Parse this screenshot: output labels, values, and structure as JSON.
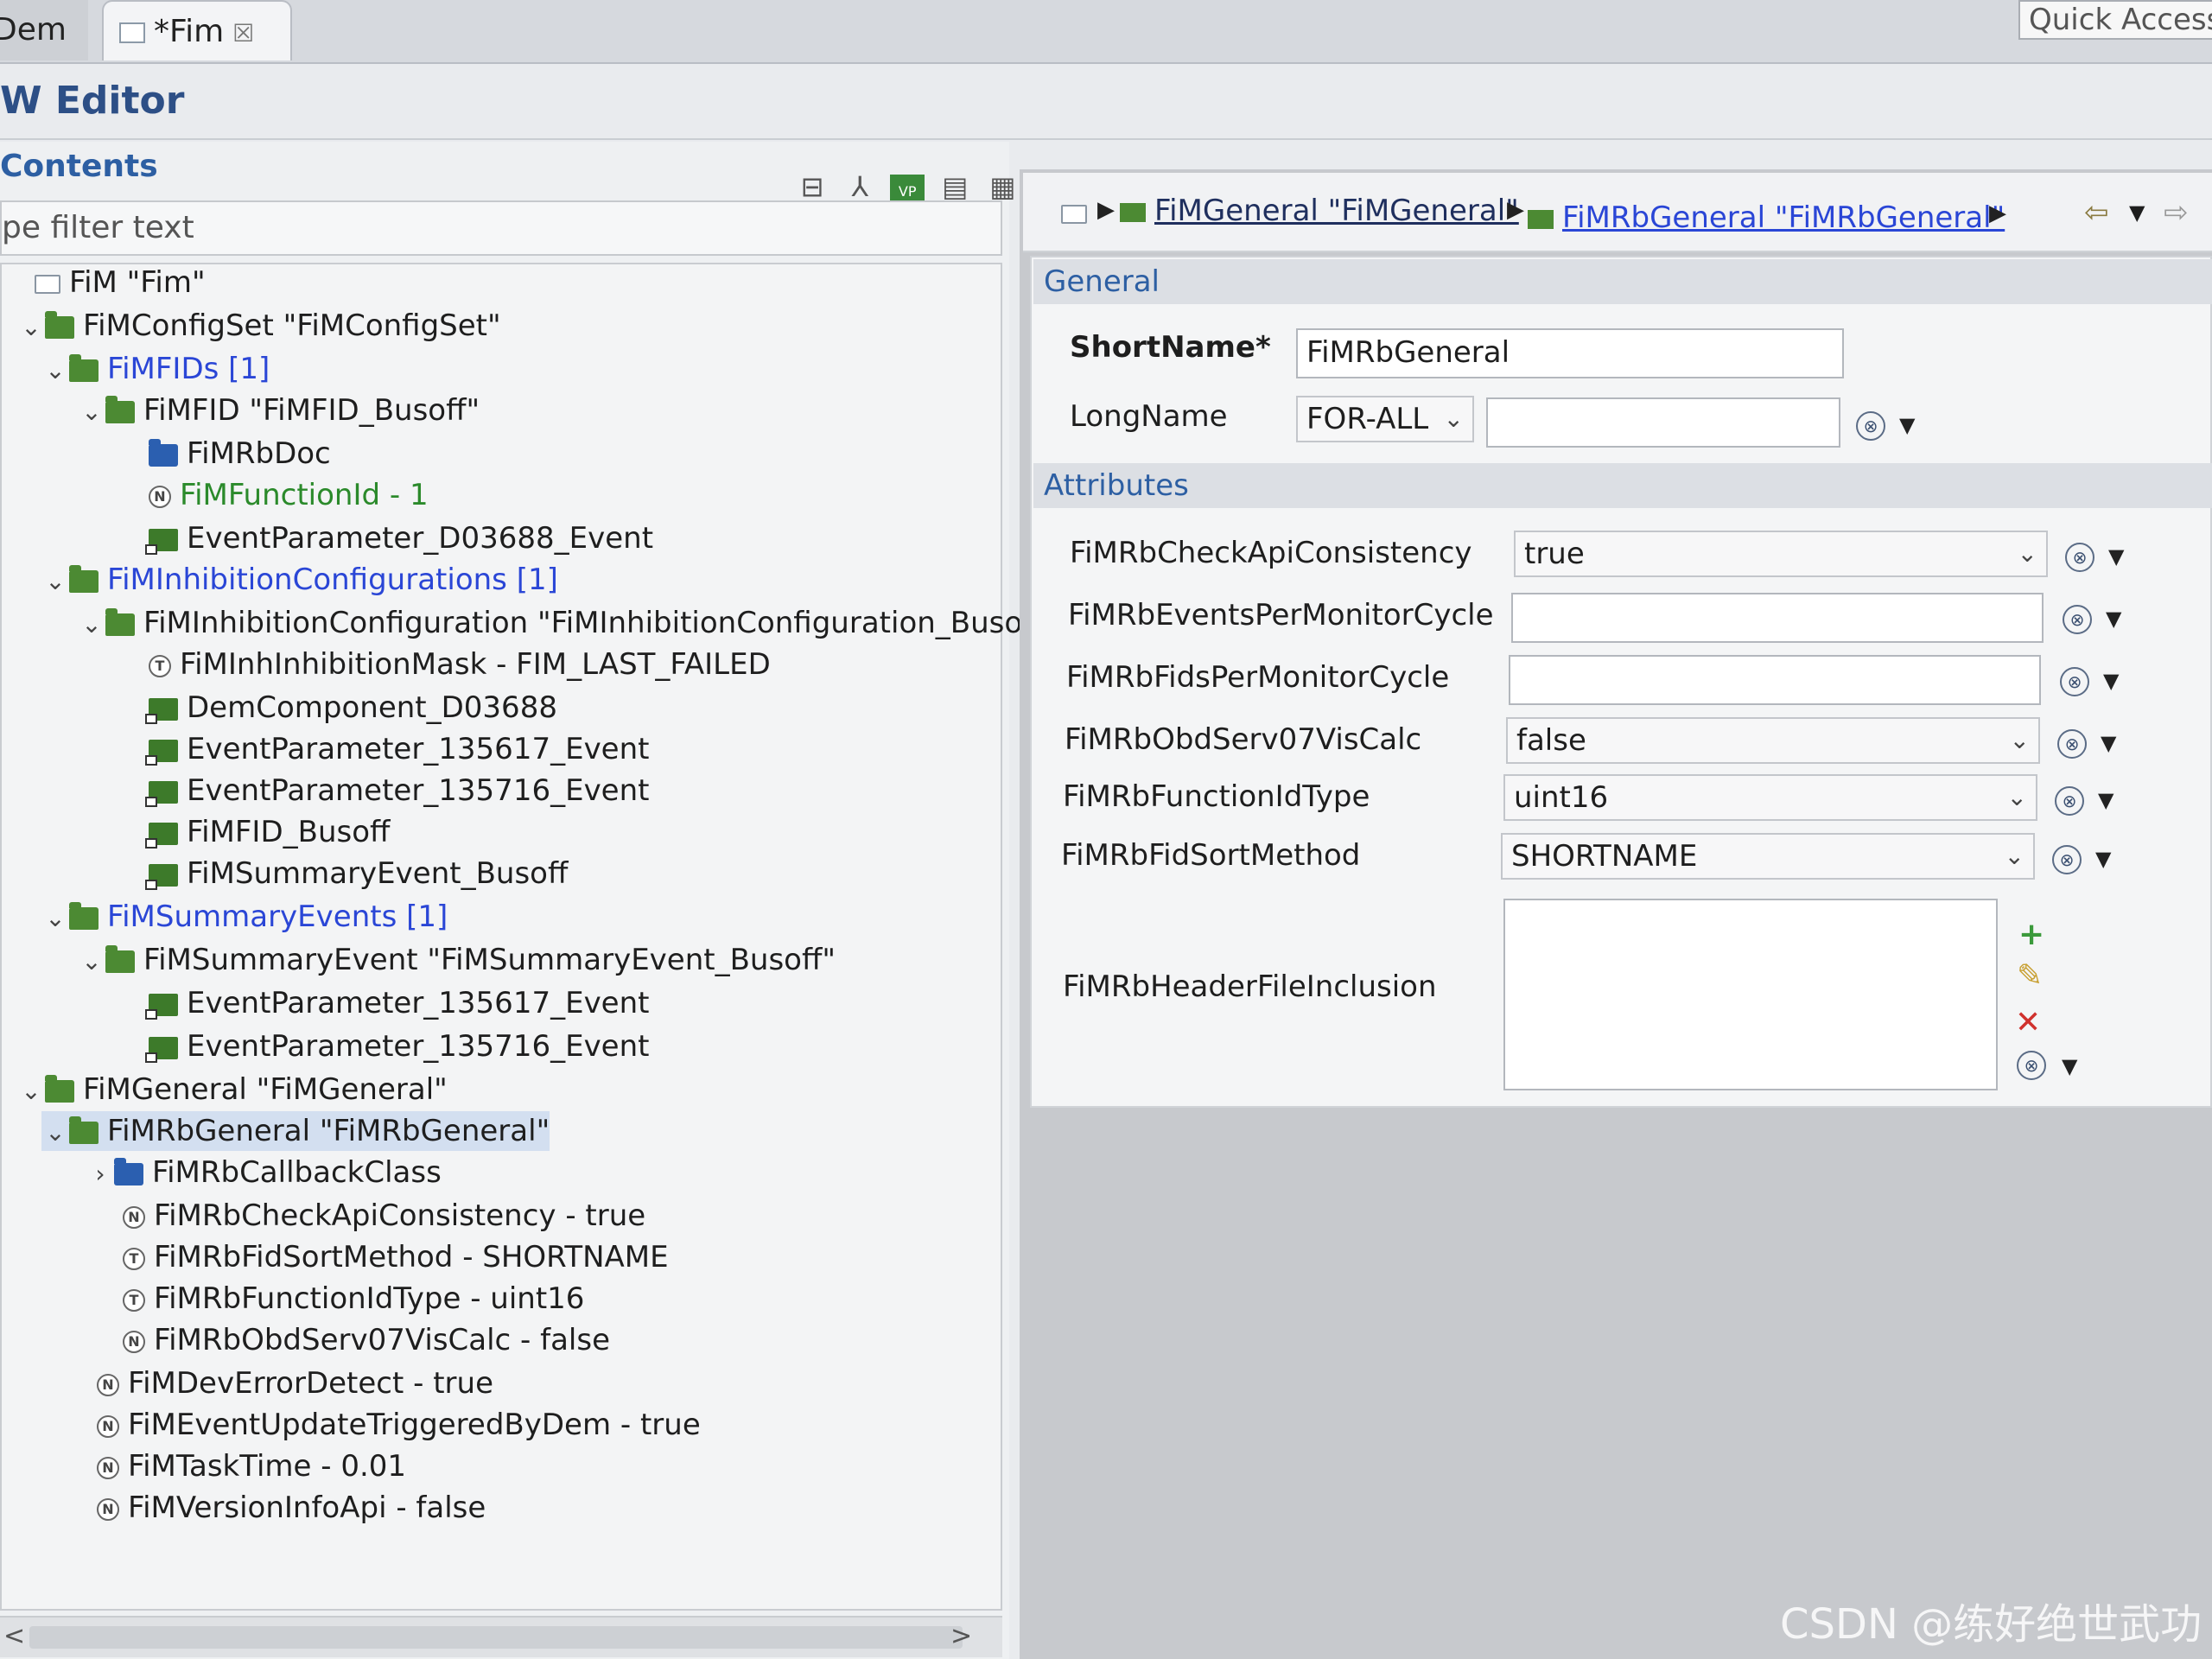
{
  "tabs": {
    "dem": "Dem",
    "fim": "*Fim",
    "close": "☒"
  },
  "quick_access": "Quick Access",
  "editor_title": "W Editor",
  "left": {
    "contents_label": "Contents",
    "filter_placeholder": "pe filter text",
    "tree": [
      {
        "label": "FiM \"Fim\"",
        "icon": "box-icon",
        "tw": "",
        "style": ""
      },
      {
        "label": "FiMConfigSet \"FiMConfigSet\"",
        "icon": "folder-icon",
        "tw": "v",
        "style": ""
      },
      {
        "label": "FiMFIDs [1]",
        "icon": "folder-icon",
        "tw": "v",
        "style": "blue"
      },
      {
        "label": "FiMFID \"FiMFID_Busoff\"",
        "icon": "folder-icon",
        "tw": "v",
        "style": ""
      },
      {
        "label": "FiMRbDoc",
        "icon": "blue-folder-icon",
        "tw": "",
        "style": ""
      },
      {
        "label": "FiMFunctionId - 1",
        "icon": "param-icon",
        "tw": "",
        "style": "green"
      },
      {
        "label": "EventParameter_D03688_Event",
        "icon": "reference-icon",
        "tw": "",
        "style": ""
      },
      {
        "label": "FiMInhibitionConfigurations [1]",
        "icon": "folder-icon",
        "tw": "v",
        "style": "blue"
      },
      {
        "label": "FiMInhibitionConfiguration \"FiMInhibitionConfiguration_Busof",
        "icon": "folder-icon",
        "tw": "v",
        "style": ""
      },
      {
        "label": "FiMInhInhibitionMask - FIM_LAST_FAILED",
        "icon": "text-param-icon",
        "tw": "",
        "style": ""
      },
      {
        "label": "DemComponent_D03688",
        "icon": "reference-icon",
        "tw": "",
        "style": ""
      },
      {
        "label": "EventParameter_135617_Event",
        "icon": "reference-icon",
        "tw": "",
        "style": ""
      },
      {
        "label": "EventParameter_135716_Event",
        "icon": "reference-icon",
        "tw": "",
        "style": ""
      },
      {
        "label": "FiMFID_Busoff",
        "icon": "reference-icon",
        "tw": "",
        "style": ""
      },
      {
        "label": "FiMSummaryEvent_Busoff",
        "icon": "reference-icon",
        "tw": "",
        "style": ""
      },
      {
        "label": "FiMSummaryEvents [1]",
        "icon": "folder-icon",
        "tw": "v",
        "style": "blue"
      },
      {
        "label": "FiMSummaryEvent \"FiMSummaryEvent_Busoff\"",
        "icon": "folder-icon",
        "tw": "v",
        "style": ""
      },
      {
        "label": "EventParameter_135617_Event",
        "icon": "reference-icon",
        "tw": "",
        "style": ""
      },
      {
        "label": "EventParameter_135716_Event",
        "icon": "reference-icon",
        "tw": "",
        "style": ""
      },
      {
        "label": "FiMGeneral \"FiMGeneral\"",
        "icon": "folder-icon",
        "tw": "v",
        "style": ""
      },
      {
        "label": "FiMRbGeneral \"FiMRbGeneral\"",
        "icon": "folder-icon",
        "tw": "v",
        "style": "selected"
      },
      {
        "label": "FiMRbCallbackClass",
        "icon": "blue-folder-icon",
        "tw": ">",
        "style": ""
      },
      {
        "label": "FiMRbCheckApiConsistency - true",
        "icon": "param-icon",
        "tw": "",
        "style": ""
      },
      {
        "label": "FiMRbFidSortMethod - SHORTNAME",
        "icon": "text-param-icon",
        "tw": "",
        "style": ""
      },
      {
        "label": "FiMRbFunctionIdType - uint16",
        "icon": "text-param-icon",
        "tw": "",
        "style": ""
      },
      {
        "label": "FiMRbObdServ07VisCalc - false",
        "icon": "param-icon",
        "tw": "",
        "style": ""
      },
      {
        "label": "FiMDevErrorDetect - true",
        "icon": "param-icon",
        "tw": "",
        "style": ""
      },
      {
        "label": "FiMEventUpdateTriggeredByDem - true",
        "icon": "param-icon",
        "tw": "",
        "style": ""
      },
      {
        "label": "FiMTaskTime - 0.01",
        "icon": "param-icon",
        "tw": "",
        "style": ""
      },
      {
        "label": "FiMVersionInfoApi - false",
        "icon": "param-icon",
        "tw": "",
        "style": ""
      }
    ]
  },
  "breadcrumb": {
    "item1": "FiMGeneral \"FiMGeneral\"",
    "item2": "FiMRbGeneral \"FiMRbGeneral\""
  },
  "general": {
    "header": "General",
    "shortname_label": "ShortName*",
    "shortname_value": "FiMRbGeneral",
    "longname_label": "LongName",
    "longname_lang": "FOR-ALL",
    "longname_value": ""
  },
  "attributes": {
    "header": "Attributes",
    "rows": [
      {
        "label": "FiMRbCheckApiConsistency",
        "value": "true",
        "kind": "combo"
      },
      {
        "label": "FiMRbEventsPerMonitorCycle",
        "value": "",
        "kind": "input"
      },
      {
        "label": "FiMRbFidsPerMonitorCycle",
        "value": "",
        "kind": "input"
      },
      {
        "label": "FiMRbObdServ07VisCalc",
        "value": "false",
        "kind": "combo"
      },
      {
        "label": "FiMRbFunctionIdType",
        "value": "uint16",
        "kind": "combo"
      },
      {
        "label": "FiMRbFidSortMethod",
        "value": "SHORTNAME",
        "kind": "combo"
      }
    ],
    "header_file_label": "FiMRbHeaderFileInclusion"
  },
  "watermark": "CSDN @练好绝世武功",
  "colors": {
    "accent": "#2d5fa3",
    "link": "#2a46d6",
    "folder": "#4c8a33"
  }
}
